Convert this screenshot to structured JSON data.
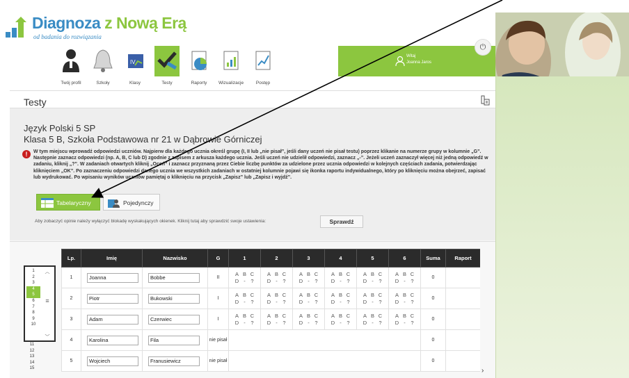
{
  "logo": {
    "title_part1": "Diagnoza z Nową Erą",
    "subtitle": "od badania do rozwiązania"
  },
  "nav": {
    "items": [
      {
        "label": "Twój profil",
        "icon": "profile-icon"
      },
      {
        "label": "Szkoły",
        "icon": "school-bell-icon"
      },
      {
        "label": "Klasy",
        "icon": "classes-icon"
      },
      {
        "label": "Testy",
        "icon": "tests-checkmark-icon"
      },
      {
        "label": "Raporty",
        "icon": "reports-icon"
      },
      {
        "label": "Wizualizacje",
        "icon": "visualizations-icon"
      },
      {
        "label": "Postęp",
        "icon": "progress-icon"
      }
    ],
    "active": "Testy"
  },
  "user": {
    "welcome": "Witaj",
    "name": "Joanna Jaros"
  },
  "page": {
    "title": "Testy",
    "subject": "Język Polski 5 SP",
    "class_line": "Klasa 5 B, Szkoła Podstawowa nr 21 w Dąbrowie Górniczej"
  },
  "info": {
    "text": "W tym miejscu wprowadź odpowiedzi uczniów. Najpierw dla każdego ucznia określ grupę (I, II lub „nie pisał”, jeśli dany uczeń nie pisał testu) poprzez klikanie na numerze grupy w kolumnie „G”. Następnie zaznacz odpowiedzi (np. A, B, C lub D) zgodnie z zapisem z arkusza każdego ucznia. Jeśli uczeń nie udzielił odpowiedzi, zaznacz „-”. Jeżeli uczeń zaznaczył więcej niż jedną odpowiedź w zadaniu, kliknij „?”. W zadaniach otwartych kliknij „Oceń” i zaznacz przyznaną przez Ciebie liczbę punktów za udzielone przez ucznia odpowiedzi w kolejnych częściach zadania, potwierdzając kliknięciem „OK”. Po zaznaczeniu odpowiedzi danego ucznia we wszystkich zadaniach w ostatniej kolumnie pojawi się ikonka raportu indywidualnego, który po kliknięciu można obejrzeć, zapisać lub wydrukować. Po wpisaniu wyników uczniów pamiętaj o kliknięciu na przycisk „Zapisz” lub „Zapisz i wyjdź”."
  },
  "tabs": {
    "tabular": "Tabelaryczny",
    "single": "Pojedynczy"
  },
  "popup": {
    "note": "Aby zobaczyć opinie należy wyłączyć blokadę wyskakujących okienek. Kliknij tutaj aby sprawdzić swoje ustawienia:",
    "check_button": "Sprawdź"
  },
  "table": {
    "headers": [
      "Lp.",
      "Imię",
      "Nazwisko",
      "G",
      "1",
      "2",
      "3",
      "4",
      "5",
      "6",
      "Suma",
      "Raport"
    ],
    "options_row1": [
      "A",
      "B",
      "C"
    ],
    "options_row2": [
      "D",
      "-",
      "?"
    ],
    "rows": [
      {
        "lp": "1",
        "first": "Joanna",
        "last": "Bobbe",
        "group": "II",
        "answered": true,
        "sum": "0"
      },
      {
        "lp": "2",
        "first": "Piotr",
        "last": "Bukowski",
        "group": "I",
        "answered": true,
        "sum": "0"
      },
      {
        "lp": "3",
        "first": "Adam",
        "last": "Czerwiec",
        "group": "I",
        "answered": true,
        "sum": "0"
      },
      {
        "lp": "4",
        "first": "Karolina",
        "last": "Fila",
        "group": "nie pisał",
        "answered": false,
        "sum": "0"
      },
      {
        "lp": "5",
        "first": "Wojciech",
        "last": "Franusiewicz",
        "group": "nie pisał",
        "answered": false,
        "sum": "0"
      }
    ]
  },
  "row_scroller": {
    "numbers": [
      "1",
      "2",
      "3",
      "4",
      "5",
      "6",
      "7",
      "8",
      "9",
      "10"
    ],
    "selected": [
      "4",
      "5"
    ],
    "extra_numbers": [
      "11",
      "12",
      "13",
      "14",
      "15"
    ]
  },
  "colors": {
    "brand_green": "#8cc63f",
    "brand_blue": "#3a8cc4",
    "header_dark": "#2b2b2b",
    "alert_red": "#c81e1e"
  }
}
